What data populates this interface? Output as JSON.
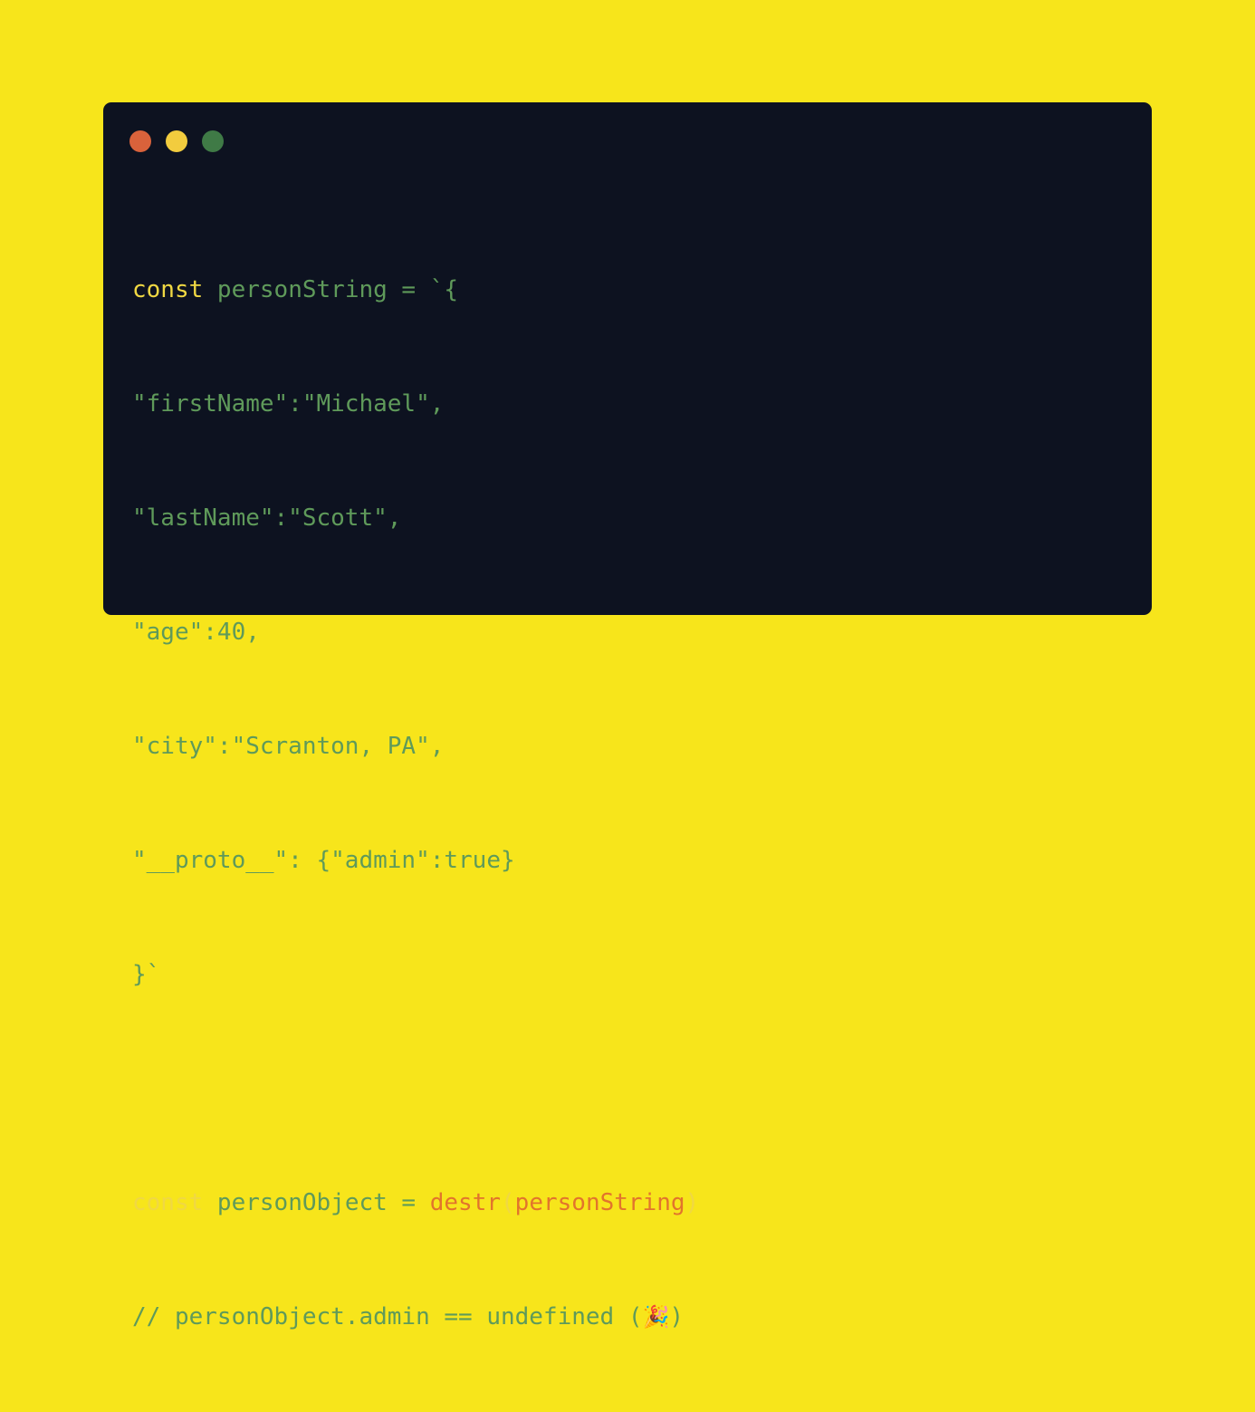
{
  "colors": {
    "background": "#f7e51b",
    "window_background": "#0d1220",
    "dot_red": "#d9623b",
    "dot_yellow": "#f2cc3e",
    "dot_green": "#3f7a46",
    "keyword": "#f0d843",
    "function": "#e2742c",
    "text": "#5f9a5a"
  },
  "window_controls": [
    {
      "name": "close-dot",
      "color": "#d9623b"
    },
    {
      "name": "minimize-dot",
      "color": "#f2cc3e"
    },
    {
      "name": "maximize-dot",
      "color": "#3f7a46"
    }
  ],
  "code": {
    "line1": {
      "keyword": "const",
      "rest": " personString = `{"
    },
    "line2": "\"firstName\":\"Michael\",",
    "line3": "\"lastName\":\"Scott\",",
    "line4": "\"age\":40,",
    "line5": "\"city\":\"Scranton, PA\",",
    "line6": "\"__proto__\": {\"admin\":true}",
    "line7": "}`",
    "line9": {
      "keyword": "const",
      "middle": " personObject = ",
      "func": "destr",
      "open_paren": "(",
      "arg": "personString",
      "close_paren": ")"
    },
    "line10": {
      "comment": "// personObject.admin == undefined (",
      "emoji": "🎉",
      "end": ")"
    }
  }
}
